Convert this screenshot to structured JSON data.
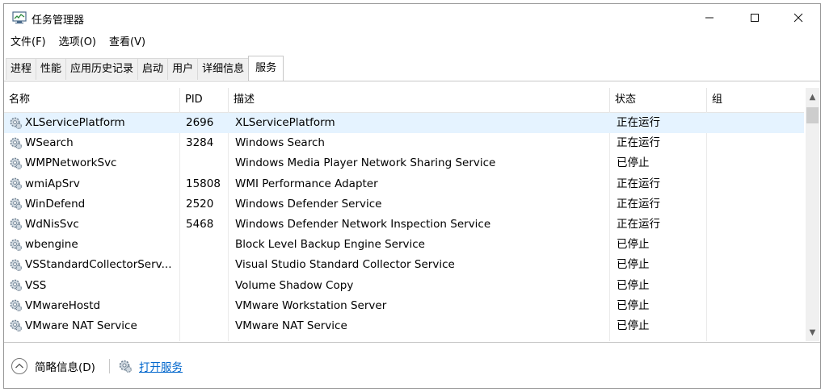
{
  "window": {
    "title": "任务管理器"
  },
  "menu": [
    "文件(F)",
    "选项(O)",
    "查看(V)"
  ],
  "tabs": [
    "进程",
    "性能",
    "应用历史记录",
    "启动",
    "用户",
    "详细信息",
    "服务"
  ],
  "active_tab": "服务",
  "columns": {
    "name": "名称",
    "pid": "PID",
    "desc": "描述",
    "status": "状态",
    "group": "组"
  },
  "rows": [
    {
      "name": "XLServicePlatform",
      "pid": "2696",
      "desc": "XLServicePlatform",
      "status": "正在运行",
      "selected": true
    },
    {
      "name": "WSearch",
      "pid": "3284",
      "desc": "Windows Search",
      "status": "正在运行"
    },
    {
      "name": "WMPNetworkSvc",
      "pid": "",
      "desc": "Windows Media Player Network Sharing Service",
      "status": "已停止"
    },
    {
      "name": "wmiApSrv",
      "pid": "15808",
      "desc": "WMI Performance Adapter",
      "status": "正在运行"
    },
    {
      "name": "WinDefend",
      "pid": "2520",
      "desc": "Windows Defender Service",
      "status": "正在运行"
    },
    {
      "name": "WdNisSvc",
      "pid": "5468",
      "desc": "Windows Defender Network Inspection Service",
      "status": "正在运行"
    },
    {
      "name": "wbengine",
      "pid": "",
      "desc": "Block Level Backup Engine Service",
      "status": "已停止"
    },
    {
      "name": "VSStandardCollectorServ...",
      "pid": "",
      "desc": "Visual Studio Standard Collector Service",
      "status": "已停止"
    },
    {
      "name": "VSS",
      "pid": "",
      "desc": "Volume Shadow Copy",
      "status": "已停止"
    },
    {
      "name": "VMwareHostd",
      "pid": "",
      "desc": "VMware Workstation Server",
      "status": "已停止"
    },
    {
      "name": "VMware NAT Service",
      "pid": "",
      "desc": "VMware NAT Service",
      "status": "已停止"
    }
  ],
  "footer": {
    "fewer_details": "简略信息(D)",
    "open_services": "打开服务"
  },
  "colors": {
    "selected_row": "#e5f3ff",
    "link": "#0066cc"
  }
}
